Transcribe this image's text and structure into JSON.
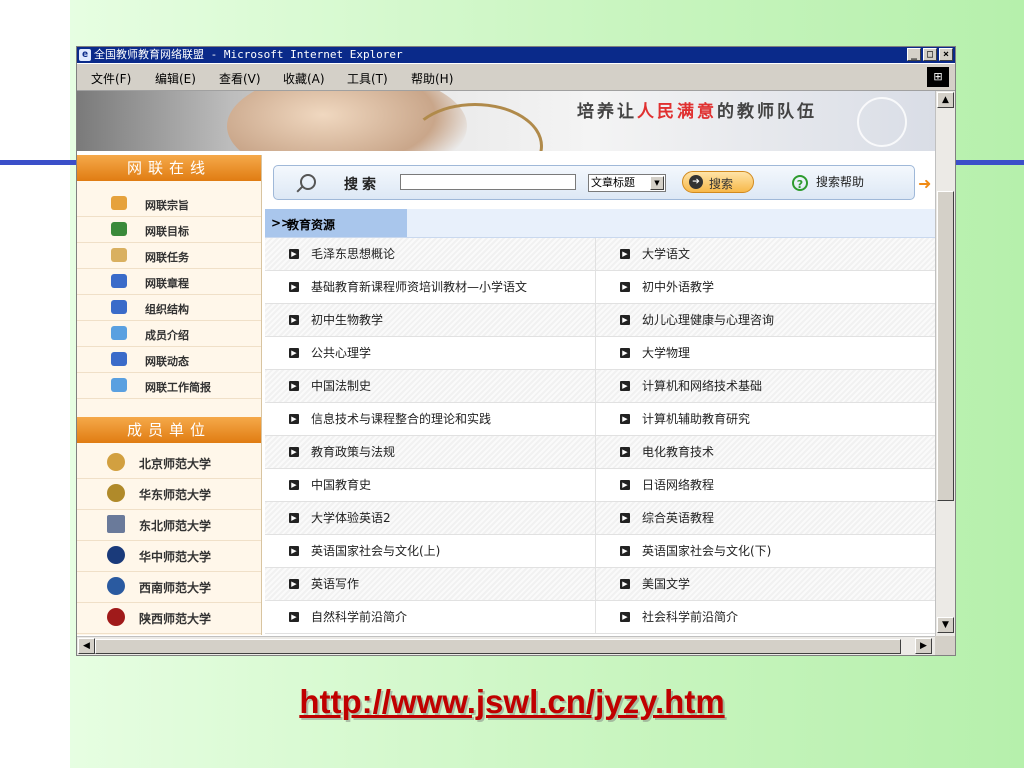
{
  "window": {
    "title": "全国教师教育网络联盟 - Microsoft Internet Explorer",
    "buttons": {
      "minimize": "_",
      "maximize": "□",
      "close": "×"
    }
  },
  "menu": {
    "items": [
      "文件(F)",
      "编辑(E)",
      "查看(V)",
      "收藏(A)",
      "工具(T)",
      "帮助(H)"
    ]
  },
  "banner": {
    "slogan_pre": "培养让",
    "slogan_red": "人民满意",
    "slogan_post": "的教师队伍"
  },
  "sidebar": {
    "header1": "网联在线",
    "items": [
      {
        "label": "网联宗旨",
        "icon": "books-icon",
        "color": "#e6a23c"
      },
      {
        "label": "网联目标",
        "icon": "document-icon",
        "color": "#3a8a3a"
      },
      {
        "label": "网联任务",
        "icon": "scroll-icon",
        "color": "#d9b060"
      },
      {
        "label": "网联章程",
        "icon": "graduation-cap-icon",
        "color": "#3a6bc9"
      },
      {
        "label": "组织结构",
        "icon": "building-icon",
        "color": "#3a6bc9"
      },
      {
        "label": "成员介绍",
        "icon": "badge-icon",
        "color": "#5aa0e0"
      },
      {
        "label": "网联动态",
        "icon": "building-icon",
        "color": "#3a6bc9"
      },
      {
        "label": "网联工作简报",
        "icon": "badge-icon",
        "color": "#5aa0e0"
      }
    ],
    "header2": "成员单位",
    "universities": [
      {
        "label": "北京师范大学",
        "color": "#d2a040"
      },
      {
        "label": "华东师范大学",
        "color": "#b08a2a"
      },
      {
        "label": "东北师范大学",
        "color": "#6a7a9a"
      },
      {
        "label": "华中师范大学",
        "color": "#1a3a7a"
      },
      {
        "label": "西南师范大学",
        "color": "#2a5aa0"
      },
      {
        "label": "陕西师范大学",
        "color": "#a01a1a"
      }
    ]
  },
  "search": {
    "label": "搜索",
    "input_value": "",
    "select_value": "文章标题",
    "button_label": "搜索",
    "help_label": "搜索帮助"
  },
  "section": {
    "title": "教育资源",
    "chevron": ">>"
  },
  "resources": {
    "rows": [
      [
        "毛泽东思想概论",
        "大学语文"
      ],
      [
        "基础教育新课程师资培训教材—小学语文",
        "初中外语教学"
      ],
      [
        "初中生物教学",
        "幼儿心理健康与心理咨询"
      ],
      [
        "公共心理学",
        "大学物理"
      ],
      [
        "中国法制史",
        "计算机和网络技术基础"
      ],
      [
        "信息技术与课程整合的理论和实践",
        "计算机辅助教育研究"
      ],
      [
        "教育政策与法规",
        "电化教育技术"
      ],
      [
        "中国教育史",
        "日语网络教程"
      ],
      [
        "大学体验英语2",
        "综合英语教程"
      ],
      [
        "英语国家社会与文化(上)",
        "英语国家社会与文化(下)"
      ],
      [
        "英语写作",
        "美国文学"
      ],
      [
        "自然科学前沿简介",
        "社会科学前沿简介"
      ]
    ]
  },
  "footer": {
    "url": "http://www.jswl.cn/jyzy.htm"
  },
  "colors": {
    "title_bar": "#0a2a8a",
    "sidebar_header": "#e07c12",
    "section_tab": "#a9c6ec",
    "url_text": "#c00000",
    "accent_blue_line": "#3b4fc9"
  }
}
